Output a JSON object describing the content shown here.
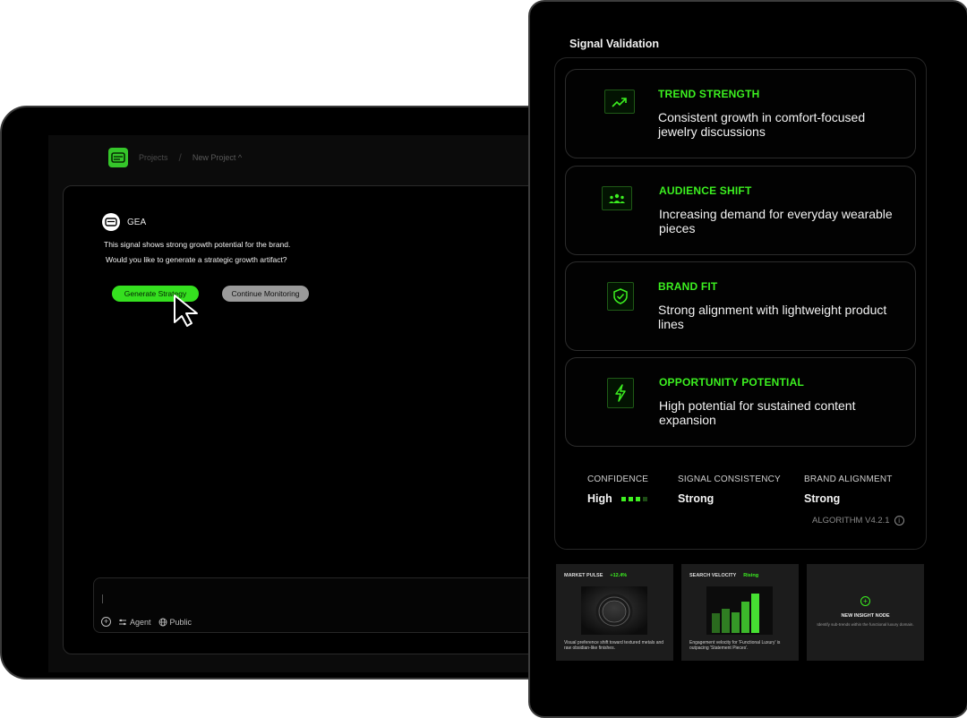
{
  "breadcrumb": {
    "projects": "Projects",
    "separator": "/",
    "current": "New Project",
    "chevron": "^"
  },
  "chat": {
    "agent_name": "GEA",
    "message_line1": "This signal shows strong growth potential for the brand.",
    "message_line2": "Would you like to generate a strategic growth artifact?",
    "primary_button": "Generate Strategy",
    "secondary_button": "Continue Monitoring"
  },
  "composer": {
    "plus": "+",
    "mode_label": "Agent",
    "visibility_label": "Public"
  },
  "signal_validation": {
    "title": "Signal Validation",
    "cards": [
      {
        "icon": "trend-up-icon",
        "title": "TREND  STRENGTH",
        "description": "Consistent growth in comfort-focused jewelry discussions"
      },
      {
        "icon": "audience-icon",
        "title": "AUDIENCE SHIFT",
        "description": "Increasing demand for everyday wearable pieces"
      },
      {
        "icon": "shield-check-icon",
        "title": "BRAND FIT",
        "description": "Strong alignment with lightweight product lines"
      },
      {
        "icon": "lightning-icon",
        "title": "OPPORTUNITY POTENTIAL",
        "description": "High potential for sustained content expansion"
      }
    ],
    "metrics": {
      "confidence_label": "CONFIDENCE",
      "confidence_value": "High",
      "confidence_level": 0.75,
      "consistency_label": "SIGNAL CONSISTENCY",
      "consistency_value": "Strong",
      "alignment_label": "BRAND ALIGNMENT",
      "alignment_value": "Strong"
    },
    "algorithm": "ALGORITHM V4.2.1",
    "info_glyph": "i"
  },
  "tiles": {
    "market_pulse": {
      "label": "MARKET PULSE",
      "delta": "+12.4%",
      "caption": "Visual preference shift toward textured metals and raw obsidian-like finishes."
    },
    "search_velocity": {
      "label": "SEARCH VELOCITY",
      "status": "Rising",
      "caption": "Engagement velocity for 'Functional Luxury' is outpacing 'Statement Pieces'."
    },
    "insight_node": {
      "plus": "+",
      "title": "NEW INSIGHT NODE",
      "description": "Identify sub-trends within the functional luxury domain."
    }
  },
  "colors": {
    "accent": "#3cf020",
    "button_green": "#35e01f",
    "button_gray": "#9a9a9a",
    "background": "#000000"
  }
}
